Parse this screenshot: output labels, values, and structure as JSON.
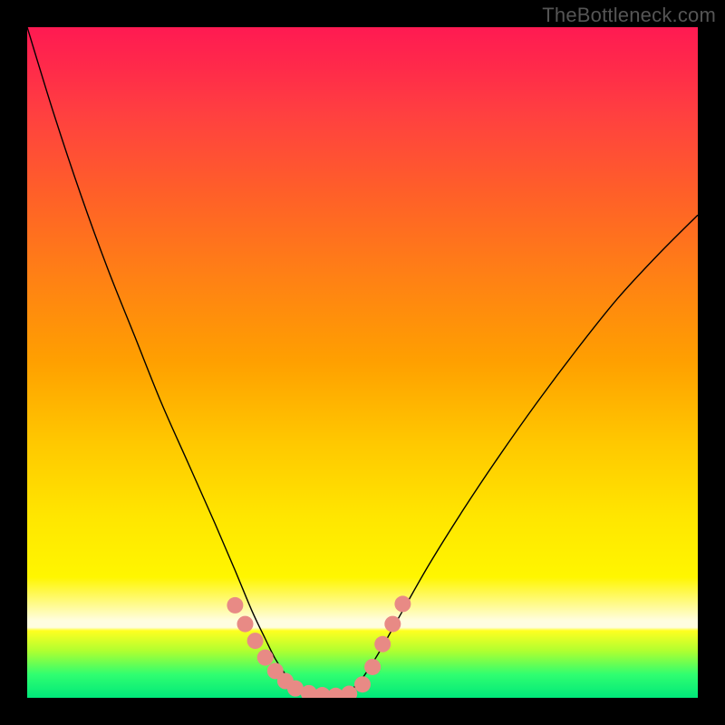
{
  "watermark": "TheBottleneck.com",
  "colors": {
    "frame": "#000000",
    "marker": "#e88a85",
    "curve": "#000000",
    "gradient_stops": [
      {
        "pos": 0.0,
        "hex": "#ff1a52"
      },
      {
        "pos": 0.06,
        "hex": "#ff2a4a"
      },
      {
        "pos": 0.13,
        "hex": "#ff4040"
      },
      {
        "pos": 0.25,
        "hex": "#ff6028"
      },
      {
        "pos": 0.37,
        "hex": "#ff8015"
      },
      {
        "pos": 0.5,
        "hex": "#ffa000"
      },
      {
        "pos": 0.62,
        "hex": "#ffc800"
      },
      {
        "pos": 0.73,
        "hex": "#ffe600"
      },
      {
        "pos": 0.82,
        "hex": "#fff600"
      },
      {
        "pos": 0.89,
        "hex": "#fffde0"
      },
      {
        "pos": 0.9,
        "hex": "#ffff20"
      },
      {
        "pos": 0.93,
        "hex": "#b0ff30"
      },
      {
        "pos": 0.965,
        "hex": "#30fe70"
      },
      {
        "pos": 1.0,
        "hex": "#00e87a"
      }
    ]
  },
  "chart_data": {
    "type": "line",
    "title": "",
    "xlabel": "",
    "ylabel": "",
    "xlim": [
      0,
      1
    ],
    "ylim": [
      0,
      1
    ],
    "note": "Axes unlabeled; x and y are normalized fractions of the plot rectangle (origin bottom-left). Two curves forming a V-shaped bottleneck indicator over a vertical red→green gradient.",
    "series": [
      {
        "name": "left-curve",
        "x": [
          0.0,
          0.04,
          0.08,
          0.12,
          0.16,
          0.2,
          0.24,
          0.28,
          0.31,
          0.335,
          0.355,
          0.37,
          0.385,
          0.4,
          0.42,
          0.44,
          0.46
        ],
        "y": [
          1.0,
          0.87,
          0.75,
          0.64,
          0.54,
          0.44,
          0.35,
          0.26,
          0.19,
          0.13,
          0.088,
          0.058,
          0.035,
          0.018,
          0.008,
          0.003,
          0.0
        ]
      },
      {
        "name": "right-curve",
        "x": [
          0.46,
          0.49,
          0.52,
          0.56,
          0.6,
          0.65,
          0.7,
          0.76,
          0.82,
          0.88,
          0.94,
          1.0
        ],
        "y": [
          0.0,
          0.018,
          0.06,
          0.13,
          0.2,
          0.28,
          0.355,
          0.44,
          0.52,
          0.595,
          0.66,
          0.72
        ]
      }
    ],
    "markers": {
      "name": "highlighted-points",
      "color": "#e88a85",
      "points": [
        {
          "x": 0.31,
          "y": 0.138
        },
        {
          "x": 0.325,
          "y": 0.11
        },
        {
          "x": 0.34,
          "y": 0.085
        },
        {
          "x": 0.355,
          "y": 0.06
        },
        {
          "x": 0.37,
          "y": 0.04
        },
        {
          "x": 0.385,
          "y": 0.025
        },
        {
          "x": 0.4,
          "y": 0.014
        },
        {
          "x": 0.42,
          "y": 0.007
        },
        {
          "x": 0.44,
          "y": 0.004
        },
        {
          "x": 0.46,
          "y": 0.003
        },
        {
          "x": 0.48,
          "y": 0.006
        },
        {
          "x": 0.5,
          "y": 0.02
        },
        {
          "x": 0.515,
          "y": 0.046
        },
        {
          "x": 0.53,
          "y": 0.08
        },
        {
          "x": 0.545,
          "y": 0.11
        },
        {
          "x": 0.56,
          "y": 0.14
        }
      ]
    }
  }
}
